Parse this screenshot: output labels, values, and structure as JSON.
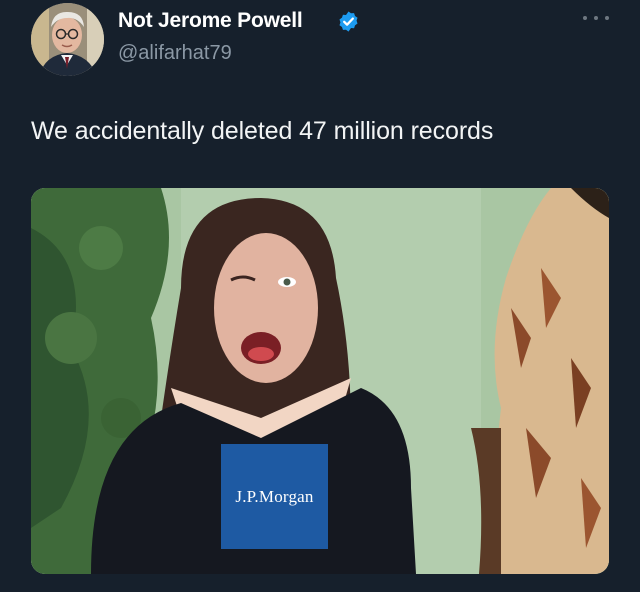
{
  "tweet": {
    "display_name": "Not Jerome Powell",
    "handle": "@alifarhat79",
    "text": "We accidentally deleted 47 million records",
    "verified": true
  },
  "media": {
    "logo_text": "J.P.Morgan",
    "logo_color": "#1e5aa3"
  },
  "icons": {
    "verified": "verified-badge-icon",
    "more": "more-options-icon"
  },
  "colors": {
    "background": "#16202c",
    "name": "#ffffff",
    "handle": "#8b98a5",
    "verified_badge": "#1d9bf0"
  }
}
